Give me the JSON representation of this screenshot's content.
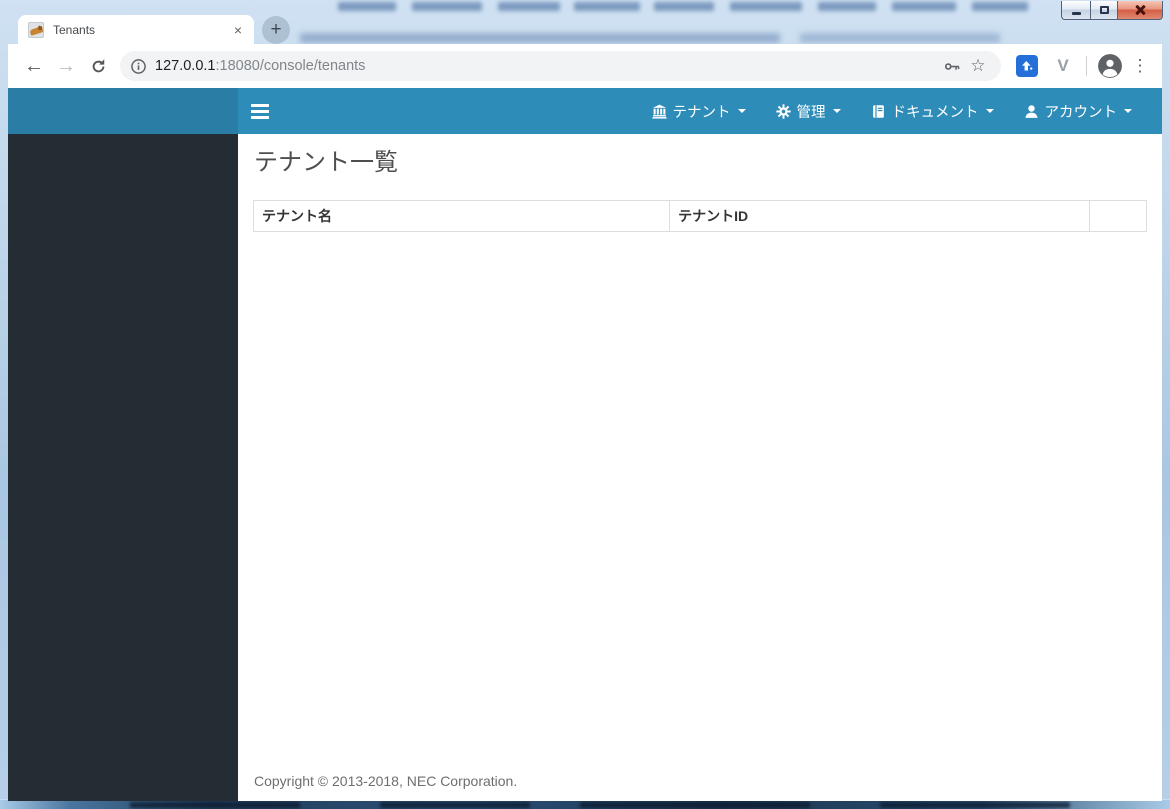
{
  "browser": {
    "tab_title": "Tenants",
    "close_tab_icon": "×",
    "new_tab_icon": "+",
    "back_icon": "←",
    "forward_icon": "→",
    "bookmark_star_icon": "☆",
    "extension_v_icon": "V",
    "menu_dots_icon": "⋮",
    "url_host": "127.0.0.1",
    "url_rest": ":18080/console/tenants"
  },
  "navbar": {
    "items": [
      {
        "label": "テナント",
        "icon": "bank-icon"
      },
      {
        "label": "管理",
        "icon": "gear-icon"
      },
      {
        "label": "ドキュメント",
        "icon": "book-icon"
      },
      {
        "label": "アカウント",
        "icon": "user-icon"
      }
    ]
  },
  "page": {
    "heading": "テナント一覧",
    "table": {
      "columns": [
        "テナント名",
        "テナントID",
        ""
      ],
      "rows": []
    },
    "footer": "Copyright © 2013-2018, NEC Corporation."
  },
  "colors": {
    "navbar": "#2e8cb8",
    "navbar_logo": "#2a7ea5",
    "sidebar": "#232d33",
    "table_border": "#dddddd",
    "close_button_red": "#d55c44",
    "omnibox_bg": "#f1f3f4"
  }
}
